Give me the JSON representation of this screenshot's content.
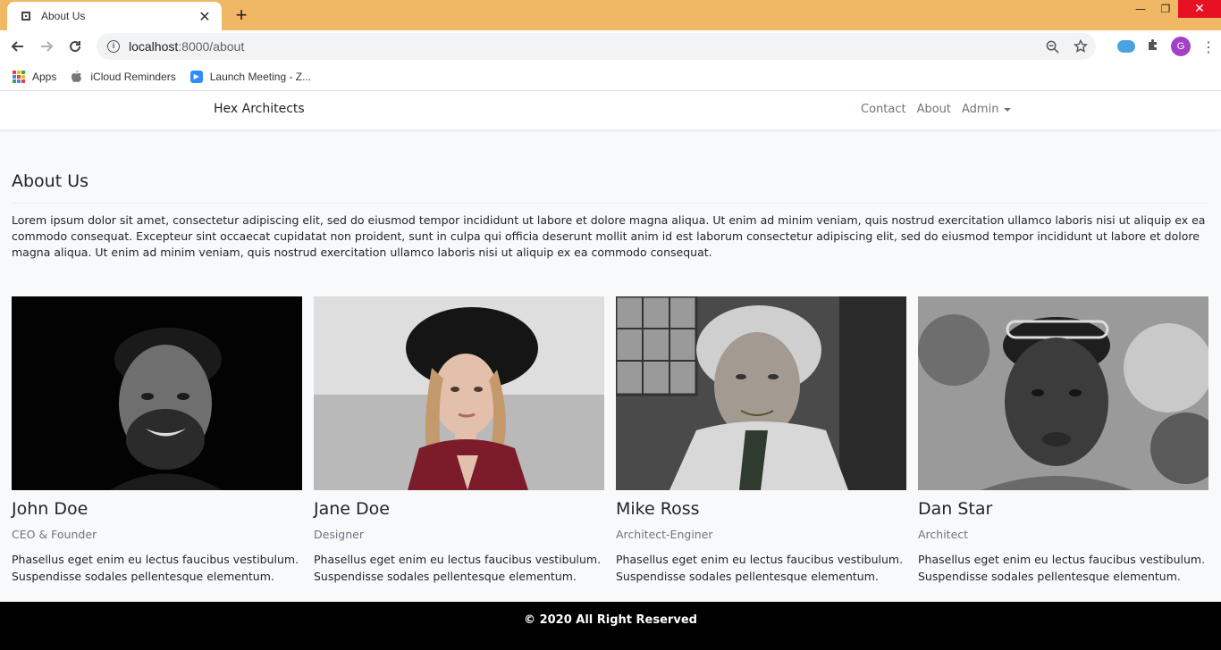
{
  "browser": {
    "tab_title": "About Us",
    "url_host": "localhost",
    "url_path": ":8000/about",
    "bookmarks": [
      {
        "label": "Apps",
        "icon": "apps-grid-icon"
      },
      {
        "label": "iCloud Reminders",
        "icon": "apple-icon"
      },
      {
        "label": "Launch Meeting - Z...",
        "icon": "zoom-icon"
      }
    ],
    "profile_initial": "G"
  },
  "navbar": {
    "brand": "Hex Architects",
    "links": [
      "Contact",
      "About",
      "Admin"
    ]
  },
  "page": {
    "title": "About Us",
    "intro": "Lorem ipsum dolor sit amet, consectetur adipiscing elit, sed do eiusmod tempor incididunt ut labore et dolore magna aliqua. Ut enim ad minim veniam, quis nostrud exercitation ullamco laboris nisi ut aliquip ex ea commodo consequat. Excepteur sint occaecat cupidatat non proident, sunt in culpa qui officia deserunt mollit anim id est laborum consectetur adipiscing elit, sed do eiusmod tempor incididunt ut labore et dolore magna aliqua. Ut enim ad minim veniam, quis nostrud exercitation ullamco laboris nisi ut aliquip ex ea commodo consequat."
  },
  "team": [
    {
      "name": "John Doe",
      "role": "CEO & Founder",
      "bio": "Phasellus eget enim eu lectus faucibus vestibulum. Suspendisse sodales pellentesque elementum."
    },
    {
      "name": "Jane Doe",
      "role": "Designer",
      "bio": "Phasellus eget enim eu lectus faucibus vestibulum. Suspendisse sodales pellentesque elementum."
    },
    {
      "name": "Mike Ross",
      "role": "Architect-Enginer",
      "bio": "Phasellus eget enim eu lectus faucibus vestibulum. Suspendisse sodales pellentesque elementum."
    },
    {
      "name": "Dan Star",
      "role": "Architect",
      "bio": "Phasellus eget enim eu lectus faucibus vestibulum. Suspendisse sodales pellentesque elementum."
    }
  ],
  "footer": {
    "text": "© 2020 All Right Reserved"
  },
  "colors": {
    "tabstrip": "#f0b865",
    "page_bg": "#f8f9fa",
    "footer_bg": "#000000",
    "muted_text": "#6c757d"
  }
}
